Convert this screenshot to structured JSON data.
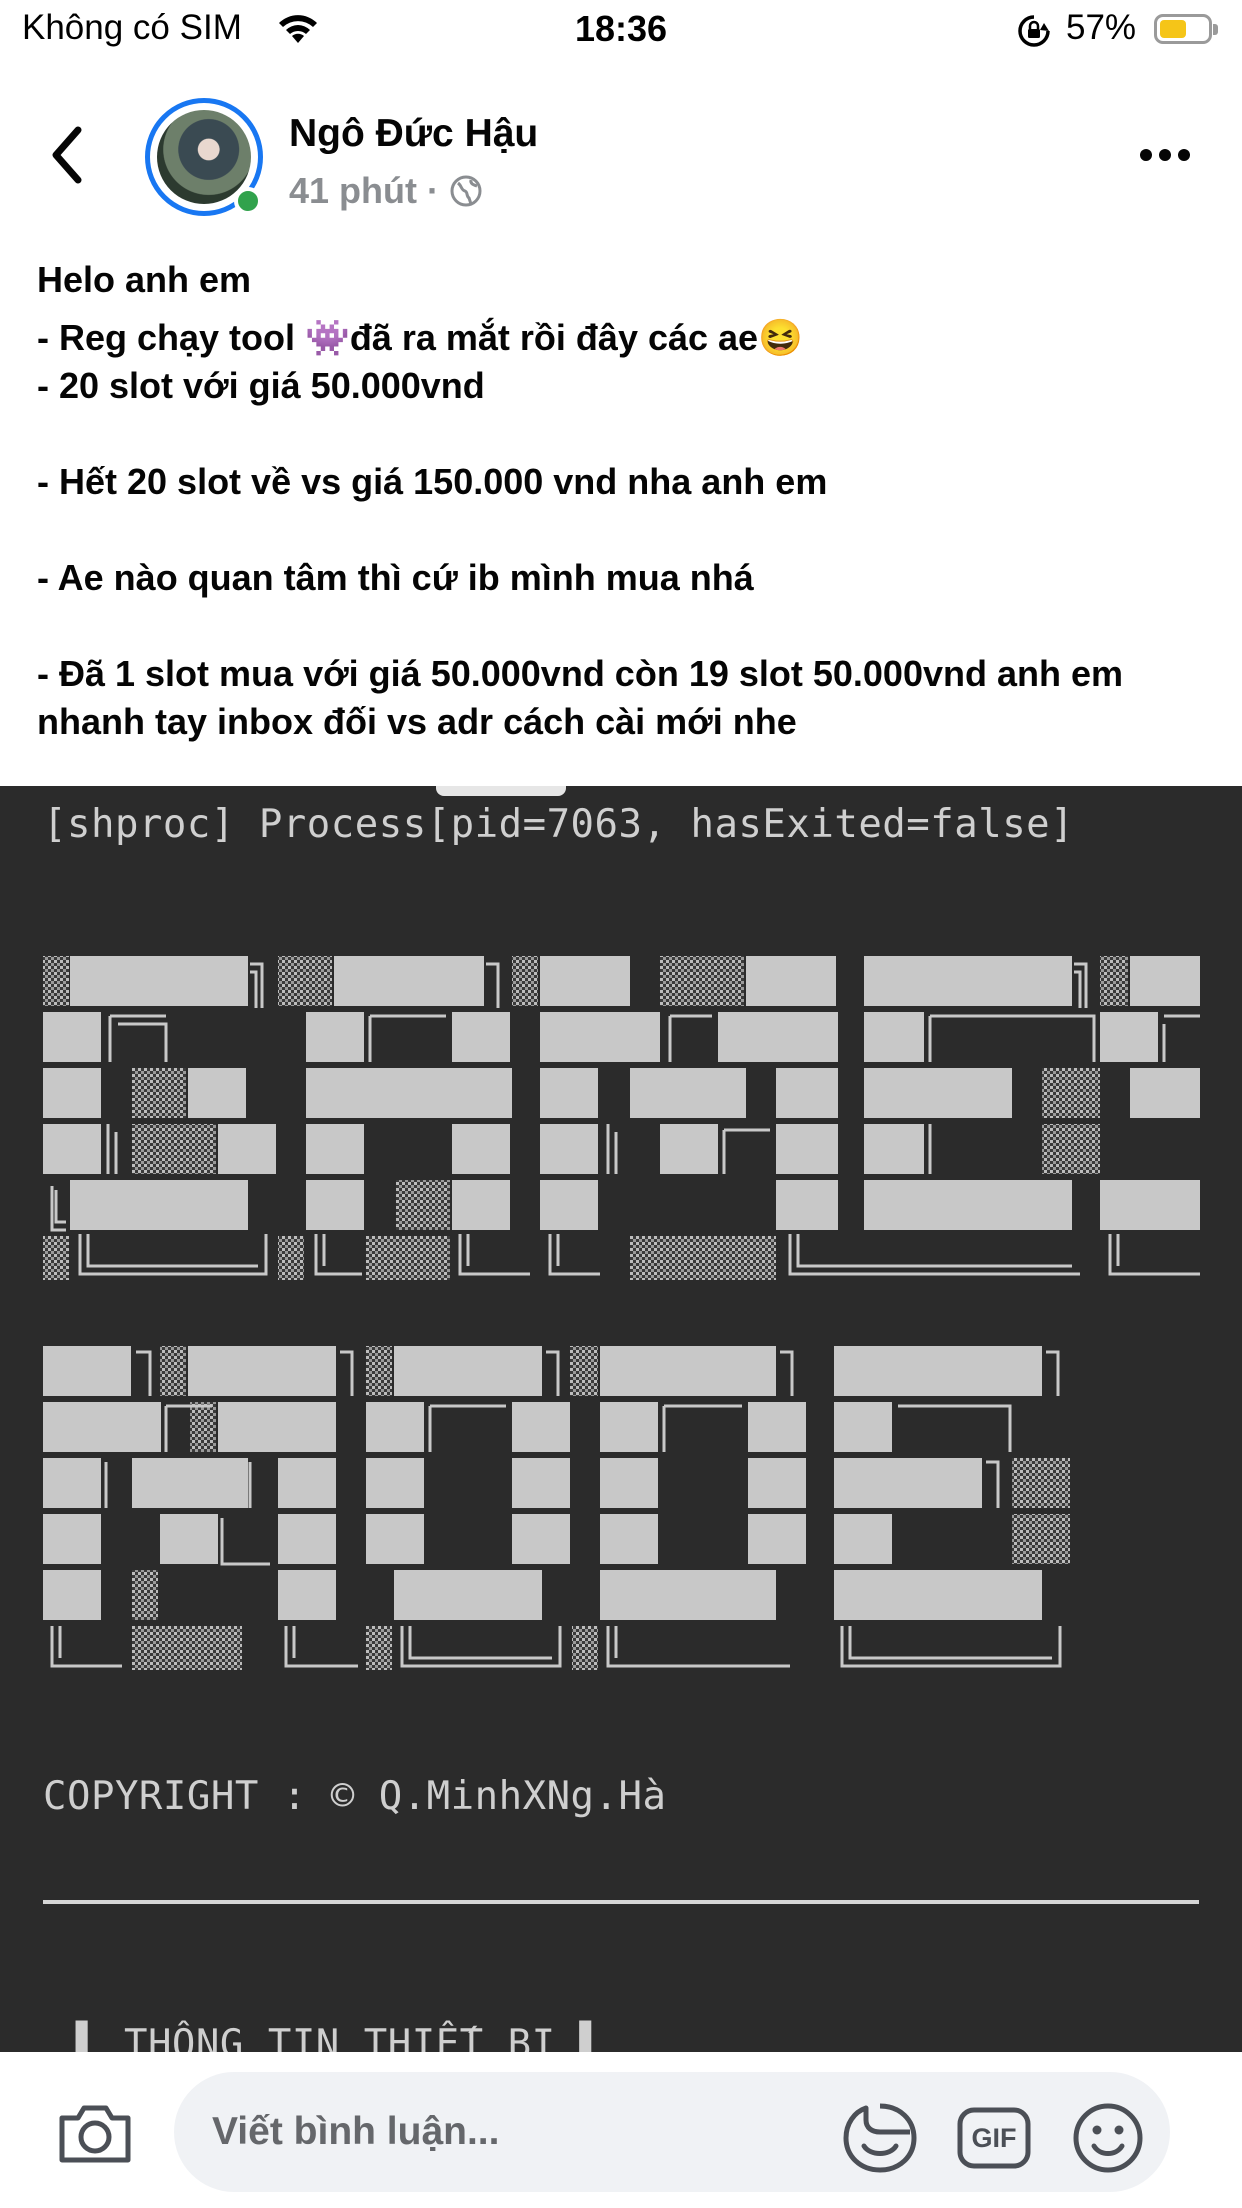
{
  "status_bar": {
    "carrier": "Không có SIM",
    "time": "18:36",
    "battery_percent_text": "57%",
    "battery_level": 0.57,
    "battery_color": "#f5c518"
  },
  "post": {
    "author": "Ngô Đức Hậu",
    "time_ago": "41 phút",
    "separator": "·",
    "privacy_icon": "globe-icon",
    "paragraphs": [
      "Helo anh em",
      "- Reg chạy tool 👾đã ra mắt rồi đây các ae😆",
      "- 20 slot với giá 50.000vnd",
      "",
      "- Hết 20 slot về vs giá 150.000 vnd nha anh em",
      "",
      "- Ae nào quan tâm thì cứ ib mình mua nhá",
      "",
      "- Đã 1 slot mua với giá 50.000vnd còn 19 slot 50.000vnd anh em nhanh tay inbox đối vs adr cách cài mới nhe"
    ]
  },
  "terminal": {
    "process_line": "[shproc] Process[pid=7063, hasExited=false]",
    "copyright_line": "COPYRIGHT : © Q.MinhXNg.Hà",
    "section_line": "▌ THÔNG TIN THIẾT BỊ ▌",
    "background": "#2b2b2b",
    "text_color": "#cfcfcf"
  },
  "comment_bar": {
    "placeholder": "Viết bình luận...",
    "camera_icon": "camera-icon",
    "sticker_icon": "sticker-icon",
    "gif_label": "GIF",
    "emoji_icon": "emoji-icon"
  }
}
